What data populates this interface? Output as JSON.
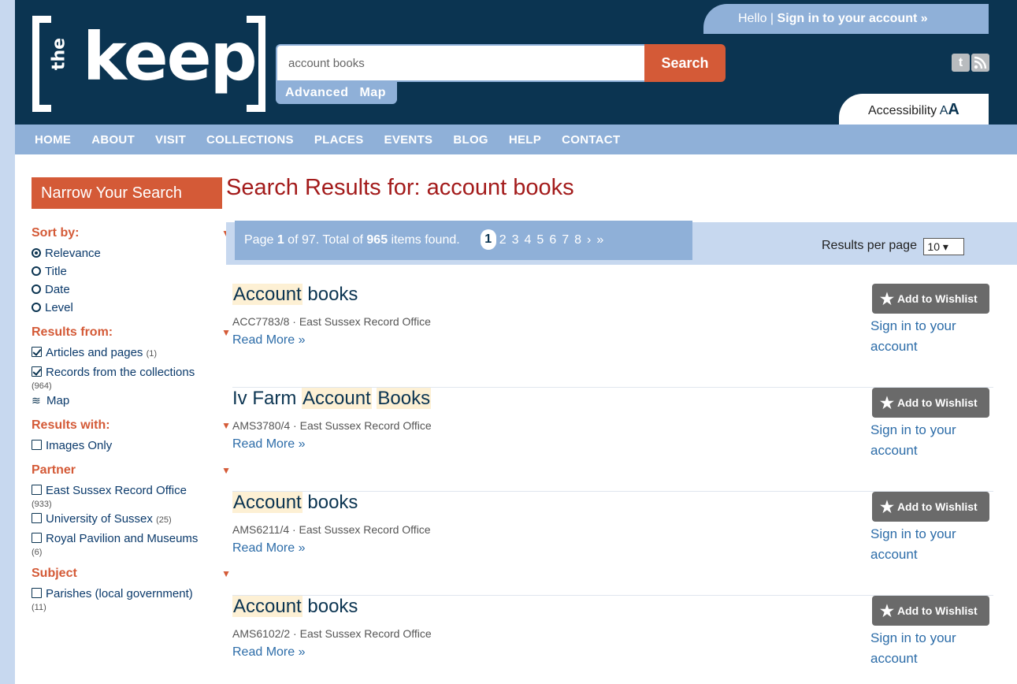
{
  "header": {
    "logo_the": "the",
    "logo_keep": "keep",
    "search_value": "account books",
    "search_button": "Search",
    "advanced_label": "Advanced",
    "map_label": "Map",
    "hello_text": "Hello | ",
    "signin_link": "Sign in to your account »",
    "accessibility_label": "Accessibility",
    "accessibility_a_small": "A",
    "accessibility_a_large": "A",
    "twitter_glyph": "t",
    "rss_glyph": "☷"
  },
  "nav": [
    "HOME",
    "ABOUT",
    "VISIT",
    "COLLECTIONS",
    "PLACES",
    "EVENTS",
    "BLOG",
    "HELP",
    "CONTACT"
  ],
  "sidebar": {
    "title": "Narrow Your Search",
    "sort_heading": "Sort by:",
    "sort_options": [
      "Relevance",
      "Title",
      "Date",
      "Level"
    ],
    "results_from_heading": "Results from:",
    "results_from": [
      {
        "label": "Articles and pages",
        "count": "(1)"
      },
      {
        "label": "Records from the collections",
        "count": "(964)"
      }
    ],
    "map_label": "Map",
    "results_with_heading": "Results with:",
    "images_only": "Images Only",
    "partner_heading": "Partner",
    "partners": [
      {
        "label": "East Sussex Record Office",
        "count": "(933)"
      },
      {
        "label": "University of Sussex",
        "count": "(25)"
      },
      {
        "label": "Royal Pavilion and Museums",
        "count": "(6)"
      }
    ],
    "subject_heading": "Subject",
    "subjects": [
      {
        "label": "Parishes (local government)",
        "count": "(11)"
      }
    ]
  },
  "main": {
    "title": "Search Results for: account books",
    "pager": {
      "page_prefix": "Page ",
      "page": "1",
      "of_text": " of 97. Total of ",
      "total": "965",
      "items_text": " items found.",
      "current": "1",
      "pages": [
        "2",
        "3",
        "4",
        "5",
        "6",
        "7",
        "8",
        "›",
        "»"
      ]
    },
    "rpp_label": "Results per page",
    "rpp_value": "10 ▾",
    "wishlist_label": "Add to Wishlist",
    "signin_text": "Sign in to your account",
    "read_more": "Read More »",
    "results": [
      {
        "pre": "",
        "hl1": "Account",
        "mid": " books",
        "hl2": "",
        "meta": "ACC7783/8 · East Sussex Record Office"
      },
      {
        "pre": "Iv Farm ",
        "hl1": "Account",
        "mid": " ",
        "hl2": "Books",
        "meta": "AMS3780/4 · East Sussex Record Office"
      },
      {
        "pre": "",
        "hl1": "Account",
        "mid": " books",
        "hl2": "",
        "meta": "AMS6211/4 · East Sussex Record Office"
      },
      {
        "pre": "",
        "hl1": "Account",
        "mid": " books",
        "hl2": "",
        "meta": "AMS6102/2 · East Sussex Record Office"
      }
    ]
  }
}
